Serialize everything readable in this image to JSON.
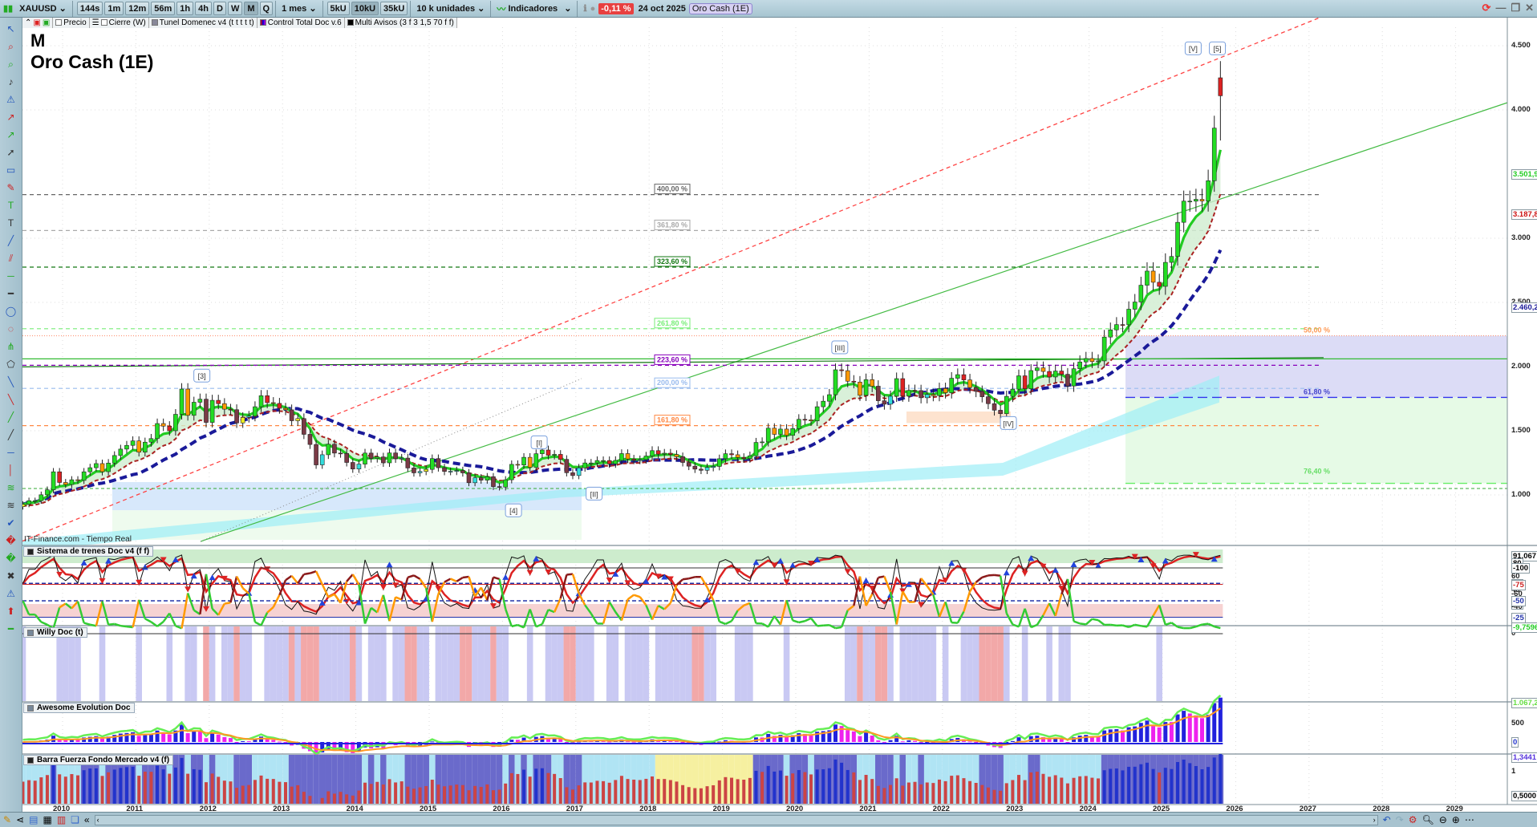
{
  "toolbar": {
    "symbol": "XAUUSD",
    "intervals": [
      "144s",
      "1m",
      "12m",
      "56m",
      "1h",
      "4h",
      "D",
      "W",
      "M",
      "Q"
    ],
    "active_interval": "M",
    "period": "1 mes",
    "units": [
      "5kU",
      "10kU",
      "35kU"
    ],
    "active_unit": "10kU",
    "units_select": "10 k unidades",
    "indicators": "Indicadores",
    "change": "-0,11 %",
    "date": "24 oct 2025",
    "instrument": "Oro Cash (1E)"
  },
  "legend": [
    "Precio",
    "Cierre (W)",
    "Tunel Domenec v4 (t t t t t)",
    "Control Total Doc v.6",
    "Multi Avisos (3 f 3 1,5 70 f f)"
  ],
  "chart_title": {
    "period": "M",
    "name": "Oro Cash (1E)"
  },
  "watermark": "IT-Finance.com - Tiempo Real",
  "colors": {
    "up": "#22dd22",
    "down": "#7a3a46",
    "ema": "#22cc22",
    "trend": "#ff3333",
    "ma": "#1a1a99"
  },
  "left_tools": [
    "pointer-icon",
    "zoom-icon",
    "zoom-area-icon",
    "bell-icon",
    "alert-icon",
    "fibonacci-icon",
    "fib-extension-icon",
    "arrow-line-icon",
    "rectangle-icon",
    "pencil-icon",
    "text-icon",
    "text-box-icon",
    "trendline-icon",
    "channel-icon",
    "horizontal-line-icon",
    "ruler-icon",
    "ellipse-icon",
    "cycle-icon",
    "pitchfork-icon",
    "polygon-icon",
    "line-icon",
    "line-2-icon",
    "diagonal-icon",
    "diagonal-2-icon",
    "h-line-icon",
    "v-line-icon",
    "wave-icon",
    "wave-2-icon",
    "check-icon",
    "thumb-up-icon",
    "delete-icon",
    "warning-icon",
    "arrow-up-icon",
    "minus-icon",
    "calc-icon"
  ],
  "chart_data": {
    "type": "candlestick",
    "start": "2009-06",
    "closes": [
      927,
      955,
      955,
      1001,
      1040,
      1180,
      1097,
      1081,
      1118,
      1113,
      1180,
      1212,
      1244,
      1181,
      1248,
      1307,
      1357,
      1386,
      1421,
      1333,
      1411,
      1439,
      1556,
      1536,
      1500,
      1628,
      1825,
      1620,
      1722,
      1746,
      1565,
      1737,
      1711,
      1668,
      1664,
      1561,
      1604,
      1614,
      1687,
      1773,
      1719,
      1713,
      1675,
      1663,
      1578,
      1595,
      1472,
      1393,
      1234,
      1313,
      1395,
      1326,
      1323,
      1253,
      1202,
      1240,
      1326,
      1284,
      1296,
      1250,
      1327,
      1282,
      1287,
      1210,
      1172,
      1183,
      1199,
      1283,
      1212,
      1183,
      1184,
      1190,
      1172,
      1095,
      1134,
      1115,
      1142,
      1065,
      1061,
      1118,
      1238,
      1233,
      1293,
      1215,
      1321,
      1350,
      1309,
      1316,
      1277,
      1173,
      1151,
      1211,
      1249,
      1249,
      1268,
      1268,
      1242,
      1269,
      1322,
      1280,
      1271,
      1275,
      1303,
      1345,
      1318,
      1325,
      1315,
      1298,
      1253,
      1224,
      1201,
      1192,
      1214,
      1222,
      1282,
      1321,
      1313,
      1292,
      1283,
      1305,
      1409,
      1413,
      1520,
      1472,
      1513,
      1464,
      1517,
      1589,
      1585,
      1577,
      1687,
      1730,
      1781,
      1975,
      1968,
      1886,
      1879,
      1776,
      1898,
      1847,
      1734,
      1707,
      1769,
      1906,
      1770,
      1814,
      1813,
      1757,
      1783,
      1774,
      1829,
      1796,
      1909,
      1937,
      1896,
      1837,
      1807,
      1765,
      1711,
      1660,
      1633,
      1768,
      1824,
      1928,
      1827,
      1969,
      1990,
      1962,
      1919,
      1965,
      1940,
      1849,
      1983,
      2036,
      2063,
      2039,
      2044,
      2230,
      2286,
      2327,
      2326,
      2447,
      2503,
      2634,
      2744,
      2657,
      2625,
      2812,
      2858,
      3124,
      3289,
      3289,
      3303,
      3290,
      3448,
      3858,
      4110
    ],
    "last_high": 4380,
    "x_ticks": [
      "2010",
      "2011",
      "2012",
      "2013",
      "2014",
      "2015",
      "2016",
      "2017",
      "2018",
      "2019",
      "2020",
      "2021",
      "2022",
      "2023",
      "2024",
      "2025",
      "2026",
      "2027",
      "2028",
      "2029"
    ],
    "y_ticks": [
      {
        "v": 4500,
        "l": "4.500"
      },
      {
        "v": 4000,
        "l": "4.000"
      },
      {
        "v": 3000,
        "l": "3.000"
      },
      {
        "v": 2500,
        "l": "2.500"
      },
      {
        "v": 2000,
        "l": "2.000"
      },
      {
        "v": 1500,
        "l": "1.500"
      },
      {
        "v": 1000,
        "l": "1.000"
      }
    ],
    "price_badges": [
      {
        "v": 3501.9,
        "l": "3.501,9",
        "c": "#22cc22"
      },
      {
        "v": 3187.8,
        "l": "3.187,8",
        "c": "#cc1111"
      },
      {
        "v": 2460.2,
        "l": "2.460,2",
        "c": "#1a1a99"
      }
    ],
    "fib_levels": [
      {
        "l": "400,00 %",
        "v": 3340,
        "c": "#666666"
      },
      {
        "l": "361,80 %",
        "v": 3060,
        "c": "#aaaaaa"
      },
      {
        "l": "323,60 %",
        "v": 2775,
        "c": "#117711"
      },
      {
        "l": "261,80 %",
        "v": 2295,
        "c": "#77ee77"
      },
      {
        "l": "223,60 %",
        "v": 2010,
        "c": "#8800bb"
      },
      {
        "l": "200,00 %",
        "v": 1830,
        "c": "#99bbee"
      },
      {
        "l": "161,80 %",
        "v": 1540,
        "c": "#ff8844"
      }
    ],
    "retrace_labels": [
      {
        "l": "50,00 %",
        "c": "#ff9955",
        "v": 2240
      },
      {
        "l": "61,80 %",
        "c": "#4444cc",
        "v": 1760
      },
      {
        "l": "76,40 %",
        "c": "#66dd66",
        "v": 1140
      }
    ],
    "waves": [
      {
        "l": "[3]",
        "t": 2011.9,
        "v": 1930
      },
      {
        "l": "[I]",
        "t": 2016.5,
        "v": 1410
      },
      {
        "l": "[II]",
        "t": 2017.25,
        "v": 1010
      },
      {
        "l": "[4]",
        "t": 2016.15,
        "v": 880
      },
      {
        "l": "[III]",
        "t": 2020.6,
        "v": 2150
      },
      {
        "l": "[IV]",
        "t": 2022.9,
        "v": 1560
      },
      {
        "l": "[V]",
        "t": 2025.42,
        "v": 4480
      },
      {
        "l": "[5]",
        "t": 2025.75,
        "v": 4480
      }
    ]
  },
  "panels": [
    {
      "title": "Sistema de trenes Doc v4 (f f)",
      "axis": [
        "91,067",
        "80",
        "60",
        "50",
        "40",
        "20",
        "0"
      ]
    },
    {
      "title": "Willy Doc (t)",
      "axis": [
        "0",
        "-9,7596",
        "-25",
        "-40",
        "-50",
        "-60",
        "-75",
        "-100"
      ]
    },
    {
      "title": "Awesome Evolution Doc",
      "axis": [
        "1.067,2",
        "500",
        "0"
      ]
    },
    {
      "title": "Barra Fuerza Fondo Mercado v4 (f)",
      "axis": [
        "1,3441",
        "1",
        "0,5000"
      ]
    }
  ]
}
